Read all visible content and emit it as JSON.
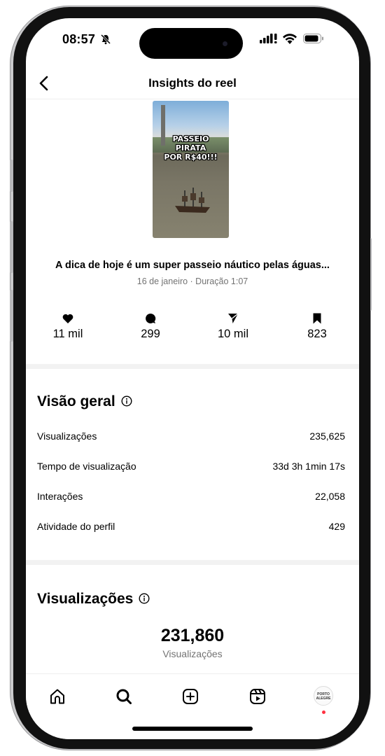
{
  "status_bar": {
    "time": "08:57"
  },
  "header": {
    "title": "Insights do reel"
  },
  "thumbnail": {
    "overlay_text": [
      "PASSEIO",
      "PIRATA",
      "POR R$40!!!"
    ]
  },
  "reel": {
    "caption": "A dica de hoje é um super passeio náutico pelas águas...",
    "meta": "16 de janeiro · Duração 1:07"
  },
  "stats": [
    {
      "icon": "heart-icon",
      "value": "11 mil"
    },
    {
      "icon": "comment-icon",
      "value": "299"
    },
    {
      "icon": "share-icon",
      "value": "10 mil"
    },
    {
      "icon": "bookmark-icon",
      "value": "823"
    }
  ],
  "overview": {
    "title": "Visão geral",
    "rows": [
      {
        "label": "Visualizações",
        "value": "235,625"
      },
      {
        "label": "Tempo de visualização",
        "value": "33d 3h 1min 17s"
      },
      {
        "label": "Interações",
        "value": "22,058"
      },
      {
        "label": "Atividade do perfil",
        "value": "429"
      }
    ]
  },
  "views": {
    "title": "Visualizações",
    "total": "231,860",
    "total_label": "Visualizações"
  },
  "tab_bar": {
    "items": [
      "home-icon",
      "search-icon",
      "create-icon",
      "reels-icon",
      "profile-avatar"
    ],
    "avatar_text": "PORTO ALEGRE"
  },
  "colors": {
    "secondary_text": "#737373",
    "divider": "#f2f2f2",
    "notification": "#ff3040"
  }
}
